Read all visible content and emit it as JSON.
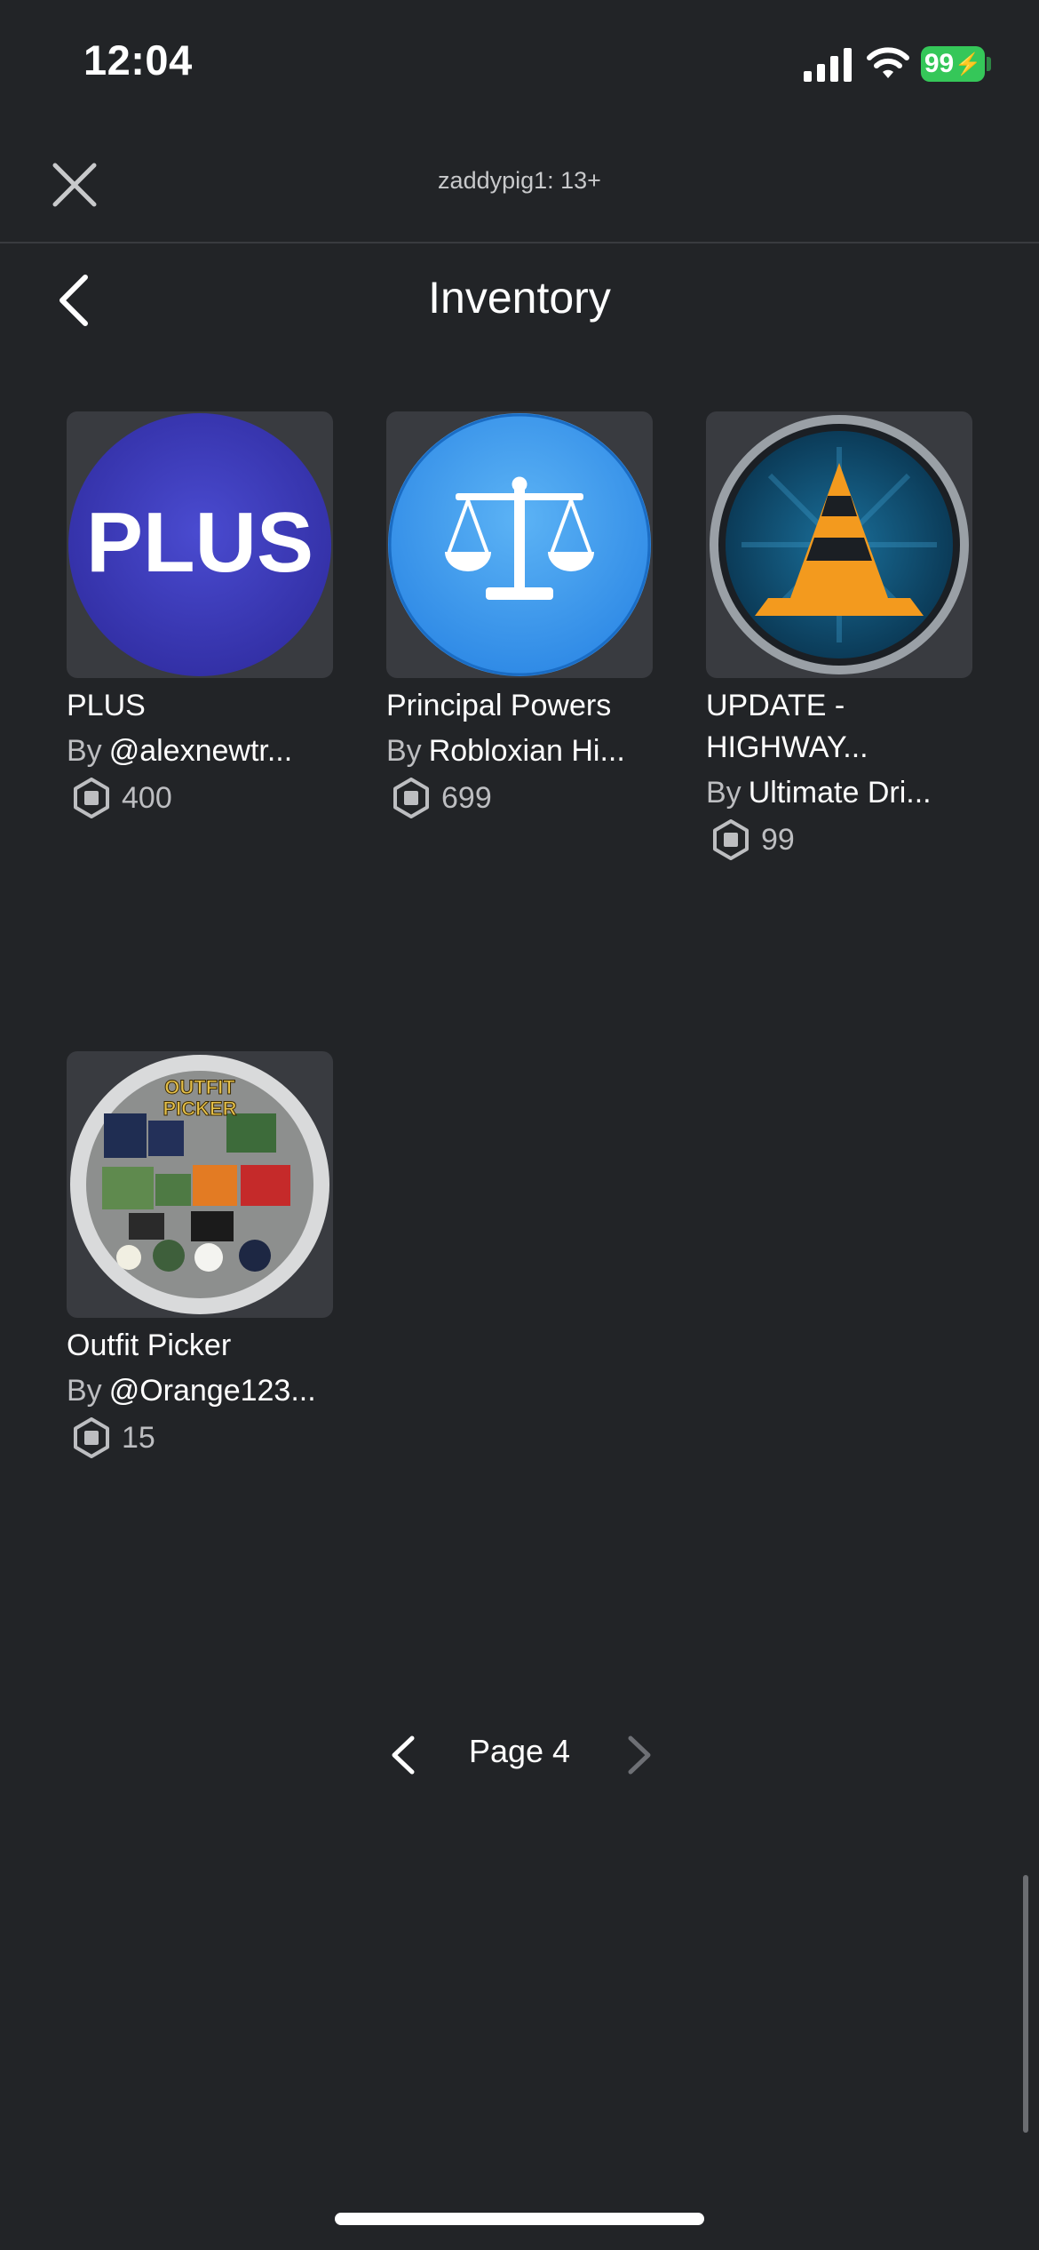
{
  "status_bar": {
    "time": "12:04",
    "battery": "99"
  },
  "header": {
    "title": "zaddypig1: 13+",
    "page_title": "Inventory"
  },
  "icons": {
    "close": "close-icon",
    "back": "chevron-left-icon",
    "robux": "robux-icon"
  },
  "items": [
    {
      "name": "PLUS",
      "by_label": "By",
      "creator": "@alexnewtr...",
      "price": "400"
    },
    {
      "name": "Principal Powers",
      "by_label": "By",
      "creator": "Robloxian Hi...",
      "price": "699"
    },
    {
      "name": "UPDATE - HIGHWAY...",
      "by_label": "By",
      "creator": "Ultimate Dri...",
      "price": "99"
    },
    {
      "name": "Outfit Picker",
      "by_label": "By",
      "creator": "@Orange123...",
      "price": "15"
    }
  ],
  "thumbnails": {
    "plus_text": "PLUS",
    "outfit_text_1": "OUTFIT",
    "outfit_text_2": "PICKER"
  },
  "pager": {
    "label": "Page 4"
  },
  "colors": {
    "background": "#222427",
    "card": "#393b40",
    "battery": "#35c759"
  }
}
